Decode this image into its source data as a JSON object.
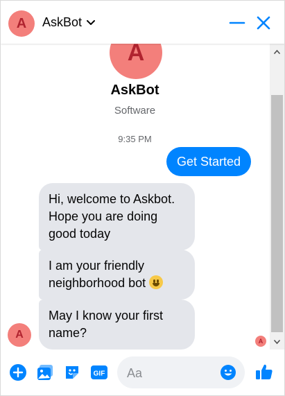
{
  "header": {
    "avatar_letter": "A",
    "title": "AskBot",
    "minimize_icon": "minus-icon",
    "close_icon": "close-icon"
  },
  "profile": {
    "avatar_letter": "A",
    "name": "AskBot",
    "subtitle": "Software"
  },
  "conversation": {
    "timestamp": "9:35 PM",
    "outgoing": [
      "Get Started"
    ],
    "incoming": [
      "Hi, welcome to Askbot. Hope you are doing good today",
      "I am your friendly neighborhood bot",
      "May I know your first name?"
    ],
    "sender_avatar_letter": "A",
    "seen_avatar_letter": "A"
  },
  "composer": {
    "placeholder": "Aa",
    "tools": [
      "plus-icon",
      "photo-icon",
      "sticker-icon",
      "gif-icon"
    ],
    "gif_label": "GIF",
    "like_icon": "thumbs-up-icon"
  },
  "colors": {
    "accent": "#0084ff",
    "avatar_bg": "#f37f7b",
    "avatar_fg": "#b0232f",
    "bubble_bg": "#e4e6eb"
  }
}
